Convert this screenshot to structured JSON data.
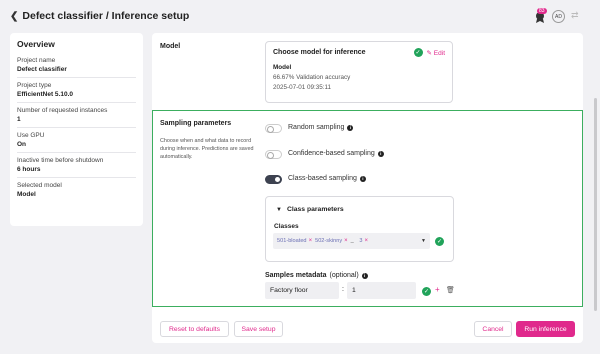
{
  "header": {
    "title": "Defect classifier / Inference setup",
    "badge_count": "83",
    "avatar": "AD"
  },
  "overview": {
    "title": "Overview",
    "items": [
      {
        "label": "Project name",
        "value": "Defect classifier"
      },
      {
        "label": "Project type",
        "value": "EfficientNet 5.10.0"
      },
      {
        "label": "Number of requested instances",
        "value": "1"
      },
      {
        "label": "Use GPU",
        "value": "On"
      },
      {
        "label": "Inactive time before shutdown",
        "value": "6 hours"
      },
      {
        "label": "Selected model",
        "value": "Model"
      }
    ]
  },
  "model_section": {
    "label": "Model",
    "card": {
      "title": "Choose model for inference",
      "edit": "Edit",
      "name": "Model",
      "accuracy": "66.67% Validation accuracy",
      "timestamp": "2025-07-01 09:35:11"
    }
  },
  "sampling": {
    "title": "Sampling parameters",
    "description": "Choose when and what data to record during inference. Predictions are saved automatically.",
    "toggles": [
      {
        "label": "Random sampling",
        "on": false
      },
      {
        "label": "Confidence-based sampling",
        "on": false
      },
      {
        "label": "Class-based sampling",
        "on": true
      }
    ],
    "class_params": {
      "title": "Class parameters",
      "classes_label": "Classes",
      "chips": [
        "501-bloated",
        "502-skinny"
      ],
      "more": "3"
    },
    "metadata": {
      "label": "Samples metadata",
      "optional": "(optional)",
      "key": "Factory floor",
      "value": "1"
    }
  },
  "footer": {
    "reset": "Reset to defaults",
    "save": "Save setup",
    "cancel": "Cancel",
    "run": "Run inference"
  },
  "colors": {
    "accent": "#e0298c",
    "success": "#21a35a",
    "highlight_border": "#3cae5f"
  }
}
